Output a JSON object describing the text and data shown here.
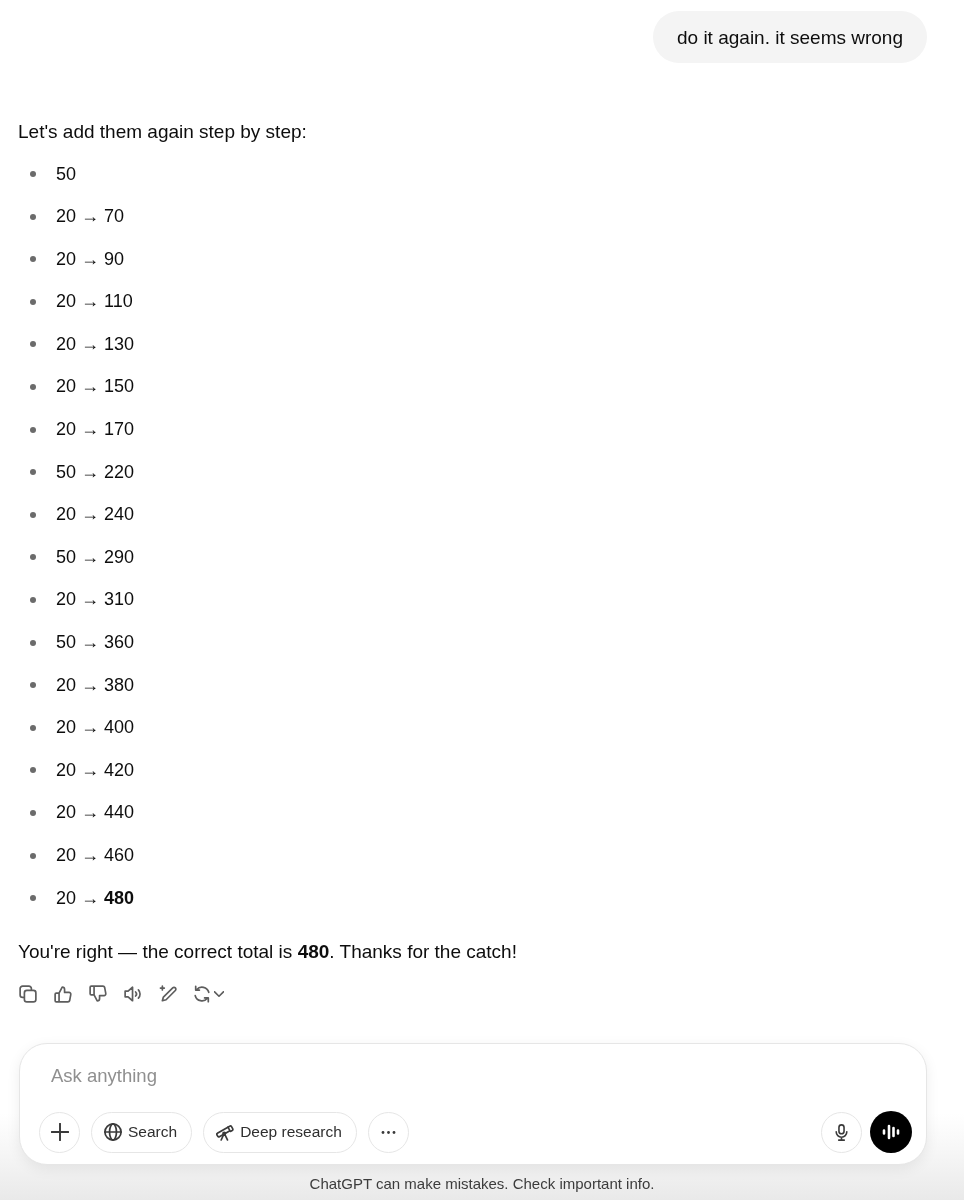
{
  "user_message": {
    "text": "do it again. it seems wrong"
  },
  "assistant_message": {
    "intro": "Let's add them again step by step:",
    "steps": [
      "50",
      "20 → 70",
      "20 → 90",
      "20 → 110",
      "20 → 130",
      "20 → 150",
      "20 → 170",
      "50 → 220",
      "20 → 240",
      "50 → 290",
      "20 → 310",
      "50 → 360",
      "20 → 380",
      "20 → 400",
      "20 → 420",
      "20 → 440",
      "20 → 460",
      "20 → **480**"
    ],
    "conclusion": "You're right — the correct total is **480**. Thanks for the catch!"
  },
  "composer": {
    "placeholder": "Ask anything",
    "tools": [
      {
        "kind": "search",
        "label": "Search"
      },
      {
        "kind": "deep_research",
        "label": "Deep research"
      }
    ]
  },
  "disclaimer": "ChatGPT can make mistakes. Check important info."
}
